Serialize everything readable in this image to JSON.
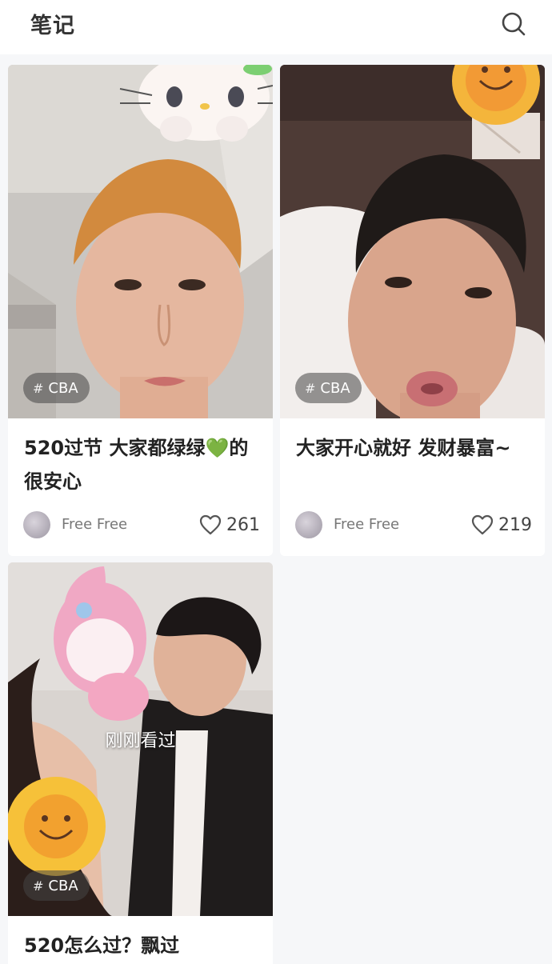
{
  "header": {
    "title": "笔记",
    "search_icon": "search-icon"
  },
  "cards": [
    {
      "title": "520过节 大家都绿绿💚的很安心",
      "tag": "CBA",
      "tag_icon": "hashtag-icon",
      "author": "Free Free",
      "likes": "261",
      "like_icon": "heart-outline-icon"
    },
    {
      "title": "大家开心就好 发财暴富~",
      "tag": "CBA",
      "tag_icon": "hashtag-icon",
      "author": "Free Free",
      "likes": "219",
      "like_icon": "heart-outline-icon"
    },
    {
      "title": "520怎么过？飘过",
      "tag": "CBA",
      "tag_icon": "hashtag-icon",
      "overlay": "刚刚看过"
    }
  ],
  "colors": {
    "card_bg": "#ffffff",
    "feed_bg": "#f6f7f9",
    "tag_bg": "#464646"
  }
}
